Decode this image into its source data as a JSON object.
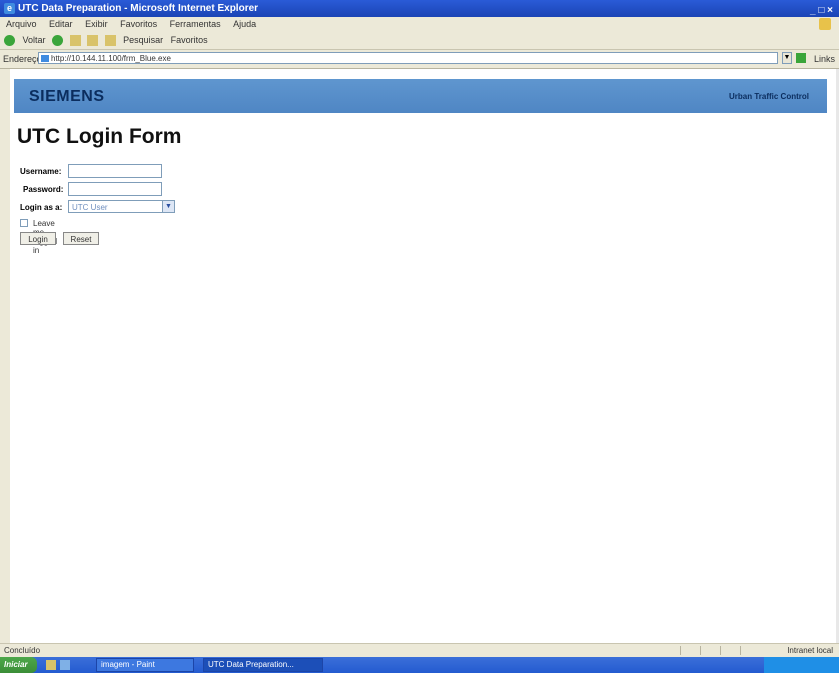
{
  "window": {
    "title": "UTC Data Preparation - Microsoft Internet Explorer",
    "controls": "_ □ ×"
  },
  "menubar": [
    "Arquivo",
    "Editar",
    "Exibir",
    "Favoritos",
    "Ferramentas",
    "Ajuda"
  ],
  "toolbar": {
    "back_label": "Voltar",
    "search_label": "Pesquisar",
    "favorites_label": "Favoritos"
  },
  "addressbar": {
    "label": "Endereço",
    "url": "http://10.144.11.100/frm_Blue.exe",
    "go_label": "Ir",
    "links_label": "Links"
  },
  "page": {
    "brand": "SIEMENS",
    "banner_right": "Urban Traffic Control",
    "heading": "UTC Login Form",
    "form": {
      "username_label": "Username:",
      "username_value": "",
      "password_label": "Password:",
      "password_value": "",
      "login_as_label": "Login as a:",
      "login_as_selected": "UTC User",
      "keep_logged_label": "Leave me logged in",
      "login_button": "Login",
      "reset_button": "Reset"
    }
  },
  "statusbar": {
    "left": "Concluído",
    "right": "Intranet local"
  },
  "taskbar": {
    "start_label": "Iniciar",
    "tasks": [
      "imagem - Paint",
      "UTC Data Preparation..."
    ]
  }
}
